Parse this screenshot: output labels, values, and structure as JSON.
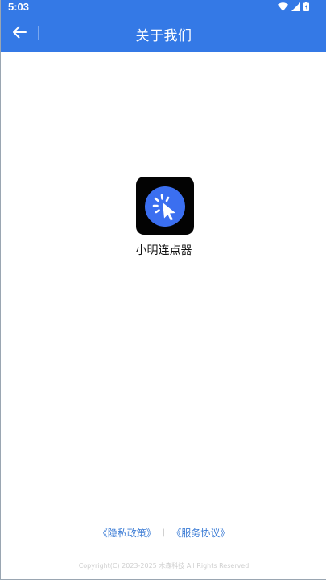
{
  "status_bar": {
    "time": "5:03",
    "icons": [
      "wifi-icon",
      "cellular-signal-icon",
      "battery-icon"
    ]
  },
  "header": {
    "title": "关于我们",
    "back_icon": "arrow-left-icon",
    "background": "#3479e6"
  },
  "app": {
    "name": "小明连点器",
    "logo_icon": "cursor-click-icon",
    "logo_accent": "#3b6ff0"
  },
  "footer": {
    "privacy_link": "《隐私政策》",
    "separator": "|",
    "service_link": "《服务协议》",
    "copyright": "Copyright(C) 2023-2025 木森科技 All Rights Reserved",
    "link_color": "#3a7bd5"
  }
}
